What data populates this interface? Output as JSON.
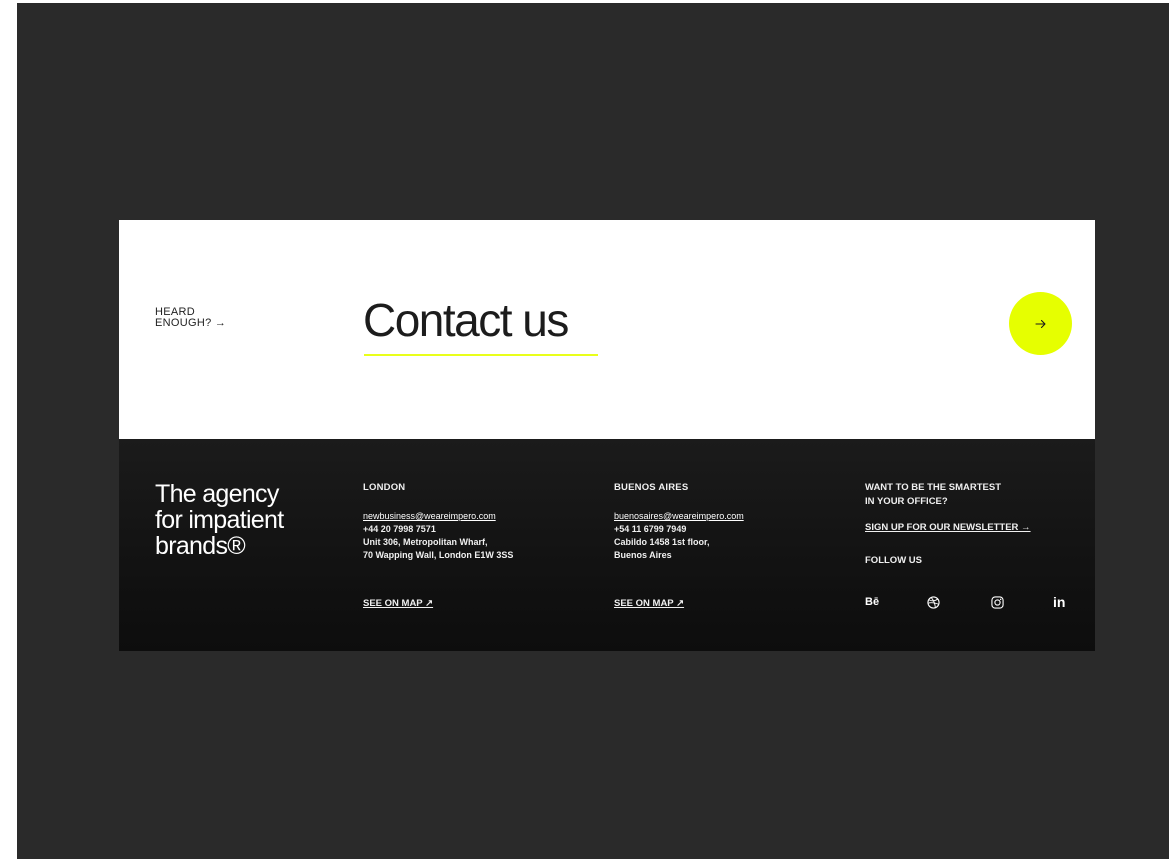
{
  "contact": {
    "heard_line1": "HEARD",
    "heard_line2": "ENOUGH? →",
    "title": "Contact us",
    "arrow": "→"
  },
  "footer": {
    "tagline": [
      "The agency",
      "for impatient",
      "brands®"
    ],
    "london": {
      "heading": "LONDON",
      "email": "newbusiness@weareimpero.com",
      "phone": "+44 20 7998 7571",
      "address1": "Unit 306, Metropolitan Wharf,",
      "address2": "70 Wapping Wall, London E1W 3SS",
      "map": "SEE ON MAP ↗"
    },
    "buenos_aires": {
      "heading": "BUENOS AIRES",
      "email": "buenosaires@weareimpero.com",
      "phone": "+54 11 6799 7949",
      "address1": "Cabildo 1458 1st floor,",
      "address2": "Buenos Aires",
      "map": "SEE ON MAP ↗"
    },
    "newsletter": {
      "question_line1": "WANT TO BE THE SMARTEST",
      "question_line2": "IN YOUR OFFICE?",
      "signup": "SIGN UP FOR OUR NEWSLETTER →",
      "follow": "FOLLOW US"
    },
    "socials": {
      "behance": "Bē",
      "linkedin": "in",
      "icons": [
        "behance-icon",
        "dribbble-icon",
        "instagram-icon",
        "linkedin-icon"
      ]
    }
  },
  "colors": {
    "accent": "#e6ff00",
    "frame": "#2a2a2a",
    "footer": "#141414"
  }
}
